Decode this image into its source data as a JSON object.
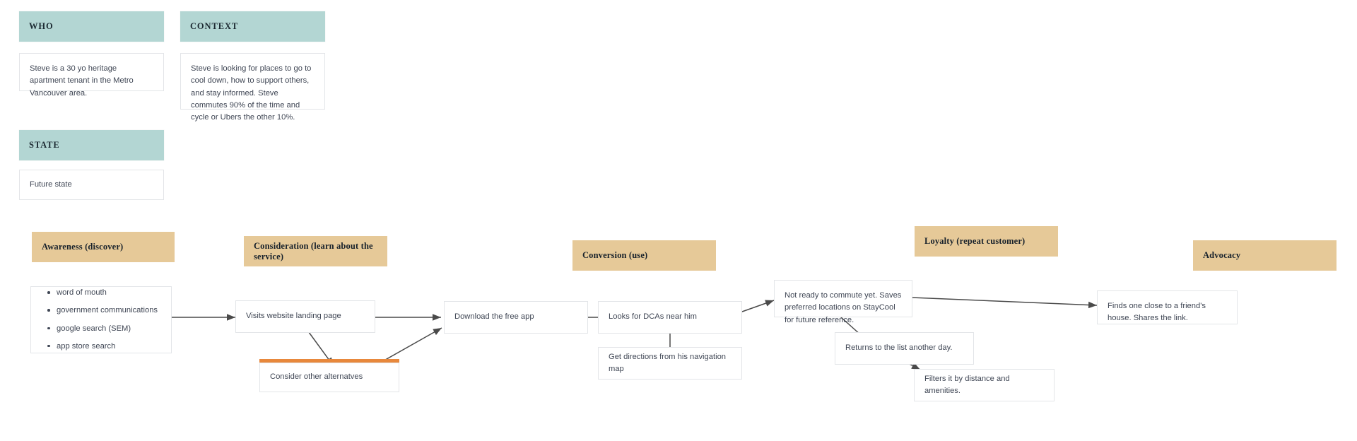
{
  "meta": {
    "title": "Customer Journey Map — Future State",
    "colors": {
      "teal_header": "#b3d6d3",
      "tan_header": "#e6c998",
      "orange_accent": "#e8883c",
      "card_border": "#e3e5e8",
      "text": "#3f4654",
      "arrow": "#4a4a4a"
    }
  },
  "persona": {
    "who": {
      "header": "WHO",
      "body": "Steve is a 30 yo heritage apartment tenant in the Metro Vancouver area."
    },
    "context": {
      "header": "CONTEXT",
      "body": "Steve is looking for places to go to cool down, how to support others, and stay informed. Steve commutes 90% of the time and cycle or Ubers the other 10%."
    },
    "state": {
      "header": "STATE",
      "body": "Future state"
    }
  },
  "stages": [
    {
      "id": "awareness",
      "label": "Awareness (discover)"
    },
    {
      "id": "consideration",
      "label": "Consideration (learn about the service)"
    },
    {
      "id": "conversion",
      "label": "Conversion (use)"
    },
    {
      "id": "loyalty",
      "label": "Loyalty (repeat customer)"
    },
    {
      "id": "advocacy",
      "label": "Advocacy"
    }
  ],
  "steps": {
    "awareness_channels": {
      "items": [
        "word of mouth",
        "government communications",
        "google search (SEM)",
        "app store search"
      ]
    },
    "visits_landing_page": {
      "text": "Visits website landing page"
    },
    "consider_alternatives": {
      "text": "Consider other alternatves"
    },
    "download_app": {
      "text": "Download the free app"
    },
    "looks_for_dcas": {
      "text": "Looks for DCAs near him"
    },
    "get_directions": {
      "text": "Get directions from his navigation map"
    },
    "not_ready": {
      "text": "Not ready to commute yet. Saves preferred locations on StayCool for future reference."
    },
    "returns_to_list": {
      "text": "Returns to the list another day."
    },
    "filters_list": {
      "text": "Filters it by distance and amenities."
    },
    "shares_link": {
      "text": "Finds one close to a friend's house. Shares the link."
    }
  }
}
